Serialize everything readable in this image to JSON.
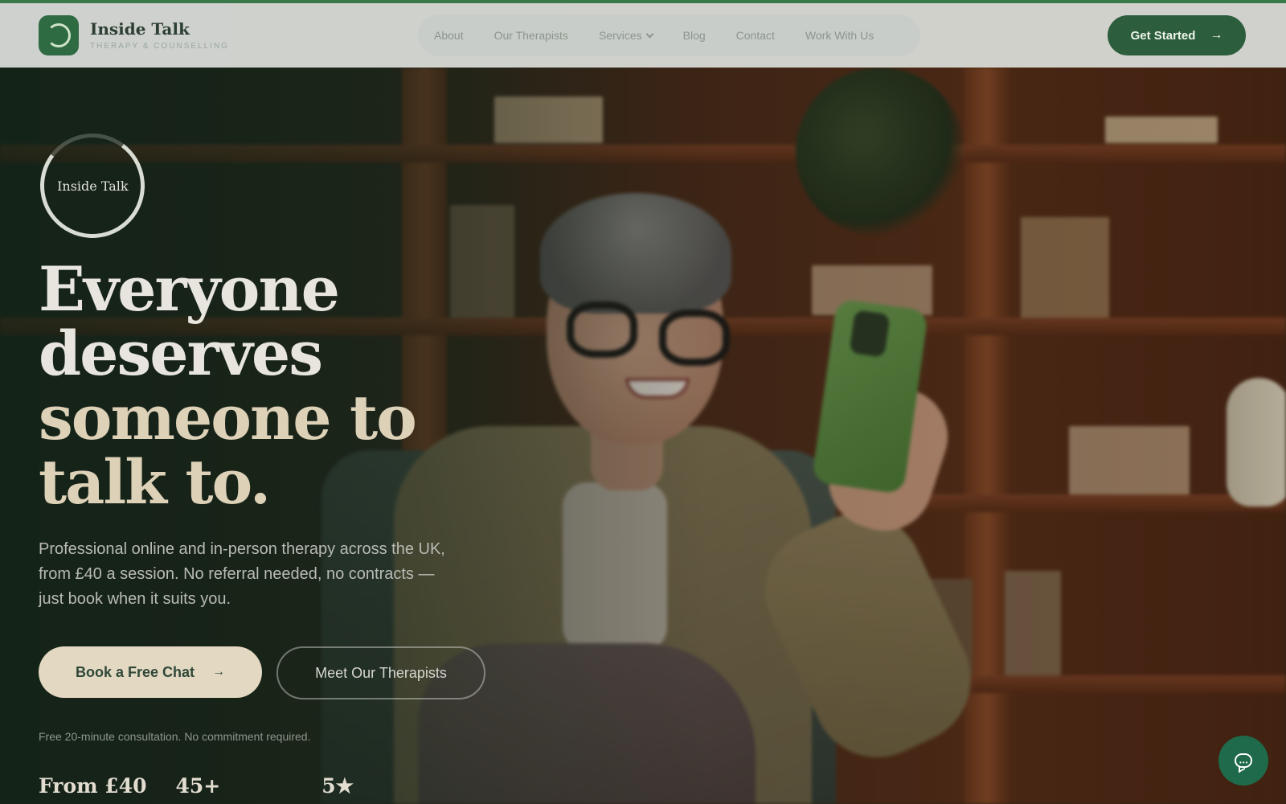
{
  "header": {
    "brand_name": "Inside Talk",
    "brand_tagline": "THERAPY & COUNSELLING",
    "nav": [
      "About",
      "Our Therapists",
      "Services",
      "Blog",
      "Contact",
      "Work With Us"
    ],
    "cta_label": "Get Started"
  },
  "hero": {
    "ring_text": "Inside Talk",
    "headline": [
      "Everyone",
      "deserves",
      "someone to",
      "talk to."
    ],
    "lead": "Professional online and in-person therapy across the UK, from £40 a session. No referral needed, no contracts — just book when it suits you.",
    "primary_button": "Book a Free Chat",
    "secondary_button": "Meet Our Therapists",
    "note": "Free 20-minute consultation. No commitment required.",
    "stats": [
      "From £40",
      "45+",
      "5★"
    ]
  },
  "colors": {
    "brand_green": "#2c5e3d",
    "cream": "#e3d8c1",
    "chat_green": "#1f6a4b"
  },
  "icons": [
    "logo-icon",
    "chevron-down-icon",
    "arrow-right-icon",
    "chat-icon"
  ]
}
